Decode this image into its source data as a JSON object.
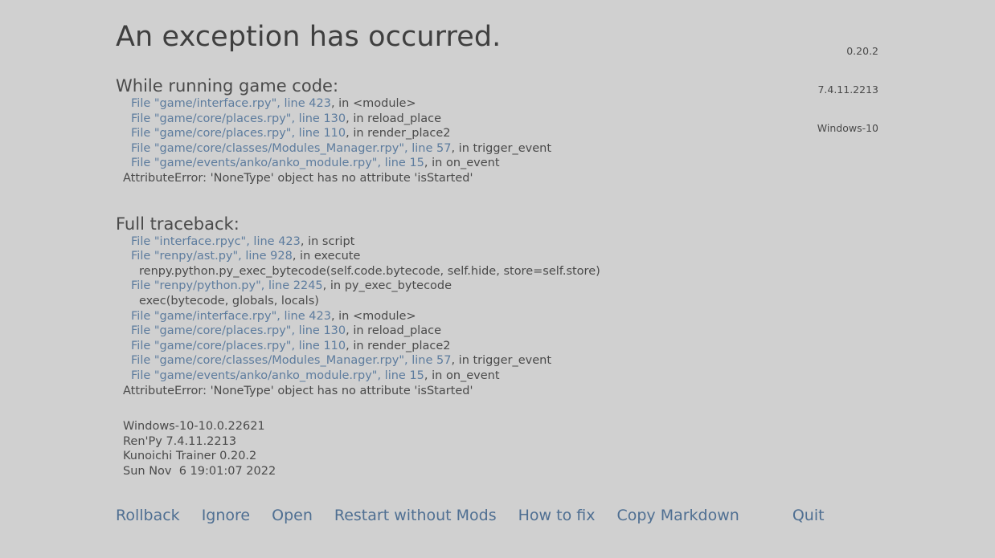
{
  "window": {
    "title": "An exception has occurred.",
    "background_color": "#d0d0d0",
    "text_color": "#4a4a4a",
    "link_color": "#5d7c9e",
    "button_color": "#4f6f92"
  },
  "version_info": {
    "game_version": "0.20.2",
    "renpy_version": "7.4.11.2213",
    "platform": "Windows-10"
  },
  "sections": {
    "running": {
      "title": "While running game code:",
      "lines": [
        {
          "kind": "file",
          "link": "File \"game/interface.rpy\", line 423",
          "rest": ", in <module>"
        },
        {
          "kind": "file",
          "link": "File \"game/core/places.rpy\", line 130",
          "rest": ", in reload_place"
        },
        {
          "kind": "file",
          "link": "File \"game/core/places.rpy\", line 110",
          "rest": ", in render_place2"
        },
        {
          "kind": "file",
          "link": "File \"game/core/classes/Modules_Manager.rpy\", line 57",
          "rest": ", in trigger_event"
        },
        {
          "kind": "file",
          "link": "File \"game/events/anko/anko_module.rpy\", line 15",
          "rest": ", in on_event"
        },
        {
          "kind": "error",
          "text": "AttributeError: 'NoneType' object has no attribute 'isStarted'"
        }
      ]
    },
    "traceback": {
      "title": "Full traceback:",
      "lines": [
        {
          "kind": "file",
          "link": "File \"interface.rpyc\", line 423",
          "rest": ", in script"
        },
        {
          "kind": "file",
          "link": "File \"renpy/ast.py\", line 928",
          "rest": ", in execute"
        },
        {
          "kind": "code",
          "text": "renpy.python.py_exec_bytecode(self.code.bytecode, self.hide, store=self.store)"
        },
        {
          "kind": "file",
          "link": "File \"renpy/python.py\", line 2245",
          "rest": ", in py_exec_bytecode"
        },
        {
          "kind": "code",
          "text": "exec(bytecode, globals, locals)"
        },
        {
          "kind": "file",
          "link": "File \"game/interface.rpy\", line 423",
          "rest": ", in <module>"
        },
        {
          "kind": "file",
          "link": "File \"game/core/places.rpy\", line 130",
          "rest": ", in reload_place"
        },
        {
          "kind": "file",
          "link": "File \"game/core/places.rpy\", line 110",
          "rest": ", in render_place2"
        },
        {
          "kind": "file",
          "link": "File \"game/core/classes/Modules_Manager.rpy\", line 57",
          "rest": ", in trigger_event"
        },
        {
          "kind": "file",
          "link": "File \"game/events/anko/anko_module.rpy\", line 15",
          "rest": ", in on_event"
        },
        {
          "kind": "error",
          "text": "AttributeError: 'NoneType' object has no attribute 'isStarted'"
        }
      ]
    }
  },
  "environment": [
    "Windows-10-10.0.22621",
    "Ren'Py 7.4.11.2213",
    "Kunoichi Trainer 0.20.2",
    "Sun Nov  6 19:01:07 2022"
  ],
  "footer_buttons": [
    {
      "label": "Rollback",
      "name": "rollback-button"
    },
    {
      "label": "Ignore",
      "name": "ignore-button"
    },
    {
      "label": "Open",
      "name": "open-button"
    },
    {
      "label": "Restart without Mods",
      "name": "restart-without-mods-button"
    },
    {
      "label": "How to fix",
      "name": "how-to-fix-button"
    },
    {
      "label": "Copy Markdown",
      "name": "copy-markdown-button"
    }
  ],
  "quit_button": {
    "label": "Quit",
    "name": "quit-button"
  }
}
